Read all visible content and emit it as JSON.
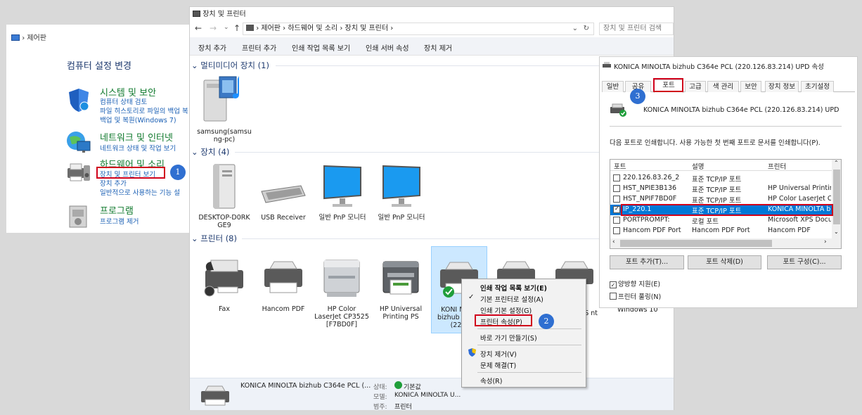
{
  "control_panel": {
    "breadcrumb": "제어판",
    "title": "컴퓨터 설정 변경",
    "categories": [
      {
        "heading": "시스템 및 보안",
        "links": [
          "컴퓨터 상태 검토",
          "파일 히스토리로 파일의 백업 복",
          "백업 및 복원(Windows 7)"
        ]
      },
      {
        "heading": "네트워크 및 인터넷",
        "links": [
          "네트워크 상태 및 작업 보기"
        ]
      },
      {
        "heading": "하드웨어 및 소리",
        "links": [
          "장치 및 프린터 보기",
          "장치 추가",
          "일반적으로 사용하는 기능 설"
        ]
      },
      {
        "heading": "프로그램",
        "links": [
          "프로그램 제거"
        ]
      }
    ]
  },
  "badges": {
    "step1": "1",
    "step2": "2",
    "step3": "3"
  },
  "devices_window": {
    "title": "장치 및 프린터",
    "address": [
      "제어판",
      "하드웨어 및 소리",
      "장치 및 프린터"
    ],
    "search_placeholder": "장치 및 프린터 검색",
    "commands": [
      "장치 추가",
      "프린터 추가",
      "인쇄 작업 목록 보기",
      "인쇄 서버 속성",
      "장치 제거"
    ],
    "groups": {
      "multimedia": "멀티미디어 장치 (1)",
      "devices": "장치 (4)",
      "printers": "프린터 (8)"
    },
    "multimedia_items": [
      "samsung(samsu ng-pc)"
    ],
    "device_items": [
      "DESKTOP-D0RK GE9",
      "USB Receiver",
      "일반 PnP 모니터",
      "일반 PnP 모니터"
    ],
    "printer_items": [
      "Fax",
      "Hancom PDF",
      "HP Color LaserJet CP3525 [F7BD0F]",
      "HP Universal Printing PS",
      "KONI MINO bizhub C PCL (220.",
      "",
      "XPS nt",
      "Windows 10"
    ],
    "status": {
      "name": "KONICA MINOLTA bizhub C364e PCL (...",
      "state_label": "상태:",
      "state_value": "기본값",
      "model_label": "모델:",
      "model_value": "KONICA MINOLTA U...",
      "category_label": "범주:",
      "category_value": "프린터"
    }
  },
  "context_menu": {
    "items": [
      "인쇄 작업 목록 보기(E)",
      "기본 프린터로 설정(A)",
      "인쇄 기본 설정(G)",
      "프린터 속성(P)",
      "바로 가기 만들기(S)",
      "장치 제거(V)",
      "문제 해결(T)",
      "속성(R)"
    ]
  },
  "properties": {
    "title": "KONICA MINOLTA bizhub C364e PCL (220.126.83.214) UPD 속성",
    "tabs": [
      "일반",
      "공유",
      "포트",
      "고급",
      "색 관리",
      "보안",
      "장치 정보",
      "초기설정"
    ],
    "printer_name": "KONICA MINOLTA bizhub C364e PCL (220.126.83.214) UPD",
    "instruction": "다음 포트로 인쇄합니다. 사용 가능한 첫 번째 포트로 문서를 인쇄합니다(P).",
    "columns": [
      "포트",
      "설명",
      "프린터"
    ],
    "ports": [
      {
        "port": "220.126.83.26_2",
        "desc": "표준 TCP/IP 포트",
        "printer": "",
        "checked": false
      },
      {
        "port": "HST_NPIE3B136",
        "desc": "표준 TCP/IP 포트",
        "printer": "HP Universal Printing",
        "checked": false
      },
      {
        "port": "HST_NPIF7BD0F",
        "desc": "표준 TCP/IP 포트",
        "printer": "HP Color LaserJet CP",
        "checked": false
      },
      {
        "port": "IP_220.1",
        "desc": "표준 TCP/IP 포트",
        "printer": "KONICA MINOLTA b",
        "checked": true
      },
      {
        "port": "PORTPROMPT:",
        "desc": "로컬 포트",
        "printer": "Microsoft XPS Docur",
        "checked": false
      },
      {
        "port": "Hancom PDF Port",
        "desc": "Hancom PDF Port",
        "printer": "Hancom PDF",
        "checked": false
      }
    ],
    "buttons": [
      "포트 추가(T)...",
      "포트 삭제(D)",
      "포트 구성(C)..."
    ],
    "checkboxes": [
      {
        "label": "양방향 지원(E)",
        "checked": true
      },
      {
        "label": "프린터 풀링(N)",
        "checked": false
      }
    ]
  }
}
